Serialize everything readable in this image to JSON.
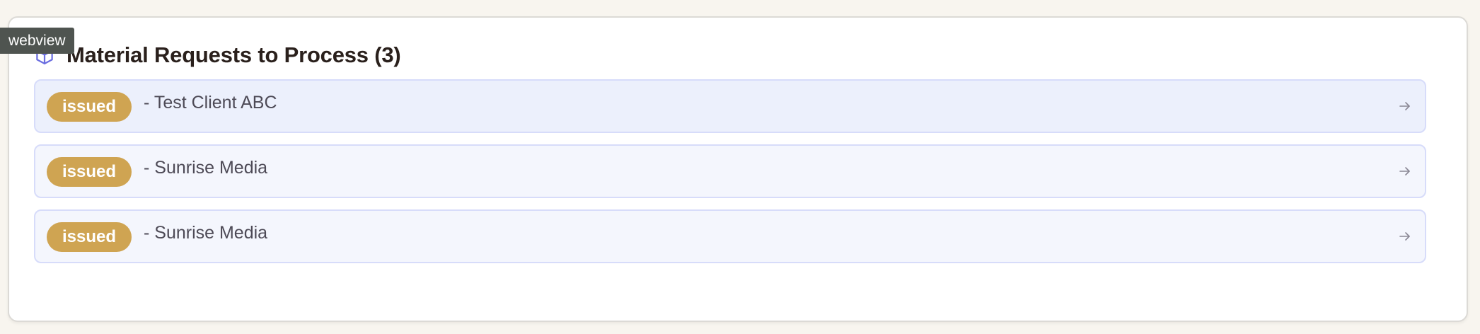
{
  "webview_label": "webview",
  "panel": {
    "title": "Material Requests to Process (3)",
    "icon": "package-icon",
    "accent_color": "#6b6ee0"
  },
  "requests": [
    {
      "status": "issued",
      "client": "- Test Client ABC",
      "status_color": "#cfa452"
    },
    {
      "status": "issued",
      "client": "- Sunrise Media",
      "status_color": "#cfa452"
    },
    {
      "status": "issued",
      "client": "- Sunrise Media",
      "status_color": "#cfa452"
    }
  ]
}
